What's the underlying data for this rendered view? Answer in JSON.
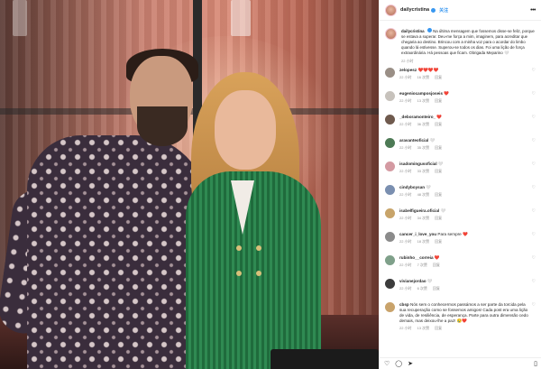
{
  "post": {
    "username": "dailycristina",
    "follow_label": "关注",
    "more_icon": "more-dots-icon",
    "caption_user": "dailycristina",
    "caption_text": "Na última mensagem que fossemos disse-se feliz, porque se estava a superar. Deu-me força a mim, imaginem, para acreditar que chegaria ao destino. Brincou com a minha voz para o acordar do limbo quando lá estivesse. Superou-se todos os dias. Foi uma lição de força extraordinária. Há pessoas que ficam. Obrigada Meparino 🤍",
    "caption_time": "22 小时"
  },
  "comments": [
    {
      "user": "zelopesz",
      "text": "❤️❤️❤️❤️",
      "time": "22 小时",
      "likes": "16 次赞",
      "reply": "回复"
    },
    {
      "user": "eugeniocamposjoseis",
      "text": "❤️",
      "time": "22 小时",
      "likes": "13 次赞",
      "reply": "回复"
    },
    {
      "user": "_deboramonteiro_",
      "text": "❤️",
      "time": "22 小时",
      "likes": "36 次赞",
      "reply": "回复"
    },
    {
      "user": "aravanteoficial",
      "text": "🤍",
      "time": "22 小时",
      "likes": "35 次赞",
      "reply": "回复"
    },
    {
      "user": "isadomingusoficial",
      "text": "🤍",
      "time": "22 小时",
      "likes": "33 次赞",
      "reply": "回复"
    },
    {
      "user": "cindyboysan",
      "text": "🤍",
      "time": "22 小时",
      "likes": "48 次赞",
      "reply": "回复"
    },
    {
      "user": "isabelfigueira.oficial",
      "text": "🤍",
      "time": "22 小时",
      "likes": "34 次赞",
      "reply": "回复"
    },
    {
      "user": "cancer_i_love_you",
      "text": "Para sempre ❤️",
      "time": "22 小时",
      "likes": "18 次赞",
      "reply": "回复"
    },
    {
      "user": "rubinho__correia",
      "text": "❤️",
      "time": "22 小时",
      "likes": "7 次赞",
      "reply": "回复"
    },
    {
      "user": "vivianejordao",
      "text": "🤍",
      "time": "22 小时",
      "likes": "6 次赞",
      "reply": "回复"
    },
    {
      "user": "cbsp",
      "text": "Nós sem o conhecermos passámos a ser parte da torcida pela sua recuperação como se fossemos amigos! Cada post era uma lição de vida, de resiliência, de esperança. Parte para outra dimensão cedo demais, mas deixou-lhe a paz! 😢❤️",
      "time": "22 小时",
      "likes": "13 次赞",
      "reply": "回复"
    }
  ],
  "actions": {
    "like_icon": "heart-icon",
    "comment_icon": "comment-icon",
    "share_icon": "share-icon",
    "save_icon": "bookmark-icon"
  },
  "colors": {
    "link_blue": "#3897f0",
    "heart_red": "#ed4956",
    "muted": "#8e8e8e"
  }
}
